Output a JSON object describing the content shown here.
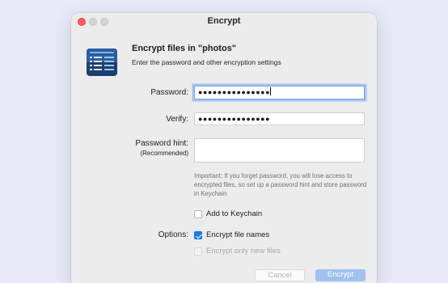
{
  "window": {
    "title": "Encrypt"
  },
  "header": {
    "heading": "Encrypt files in \"photos\"",
    "subheading": "Enter the password and other encryption settings",
    "icon": "encrypto-app-icon"
  },
  "form": {
    "password_label": "Password:",
    "password_value": "●●●●●●●●●●●●●●●",
    "verify_label": "Verify:",
    "verify_value": "●●●●●●●●●●●●●●●",
    "hint_label": "Password hint:",
    "hint_sublabel": "(Recommended)",
    "hint_value": "",
    "note": "Important: If you forget password, you will lose access to encrypted files, so set up a password hint and store password in Keychain"
  },
  "keychain": {
    "label": "Add to Keychain",
    "checked": false
  },
  "options": {
    "label": "Options:",
    "encrypt_names_label": "Encrypt file names",
    "encrypt_names_checked": true,
    "encrypt_new_label": "Encrypt only new files",
    "encrypt_new_checked": false,
    "encrypt_new_disabled": true
  },
  "buttons": {
    "cancel": "Cancel",
    "encrypt": "Encrypt"
  }
}
